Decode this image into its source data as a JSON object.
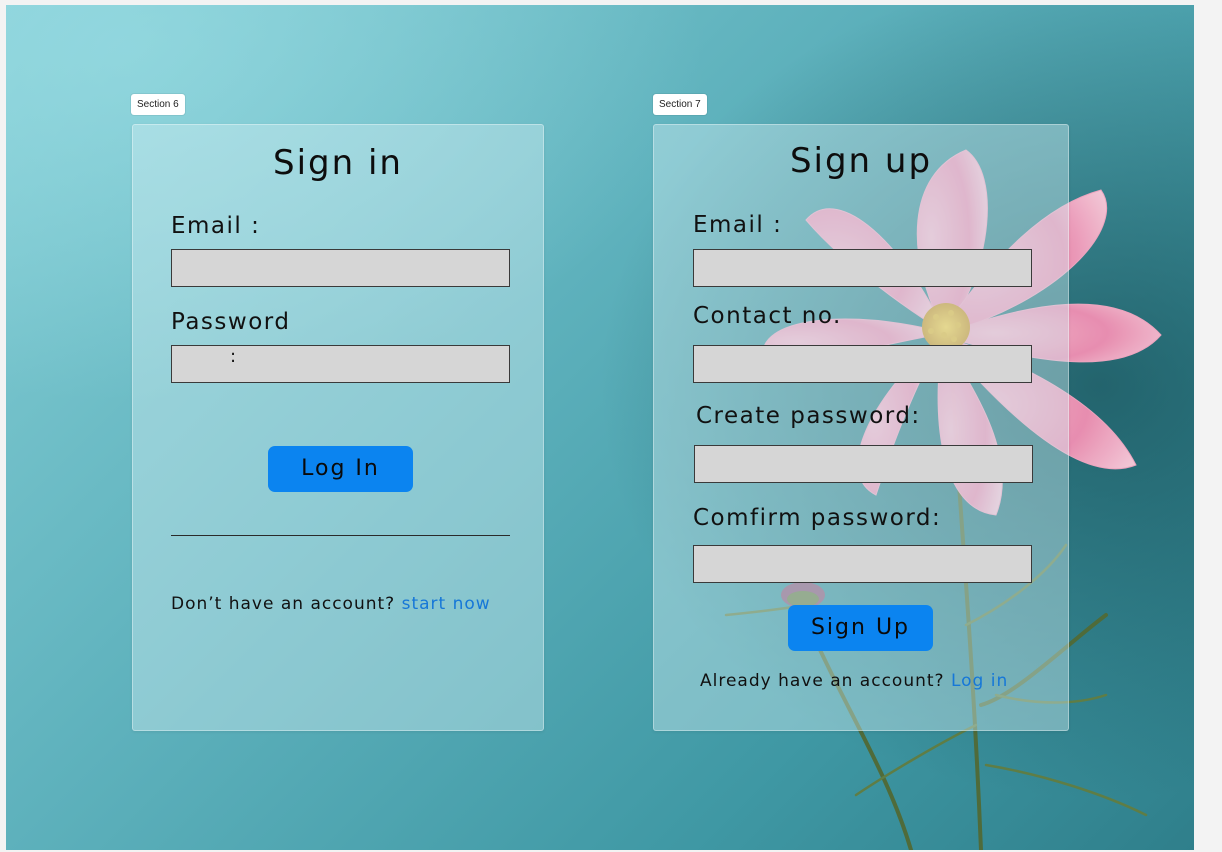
{
  "sections": {
    "left_tag": "Section 6",
    "right_tag": "Section 7"
  },
  "signin": {
    "title": "Sign in",
    "email_label": "Email :",
    "email_value": "",
    "password_label": "Password",
    "password_colon": ":",
    "password_value": "",
    "login_button": "Log In",
    "footer_text": "Don’t have an account? ",
    "footer_link": "start now"
  },
  "signup": {
    "title": "Sign up",
    "email_label": "Email :",
    "contact_label": "Contact no.",
    "create_password_label": "Create password:",
    "confirm_password_label": "Comfirm  password:",
    "signup_button": "Sign Up",
    "footer_text": "Already have an account? ",
    "footer_link": "Log in"
  },
  "colors": {
    "accent": "#0b84f0",
    "link": "#1677d8",
    "field": "#d6d6d6"
  },
  "decor": {
    "background_image": "pink-cosmos-flower-icon"
  }
}
